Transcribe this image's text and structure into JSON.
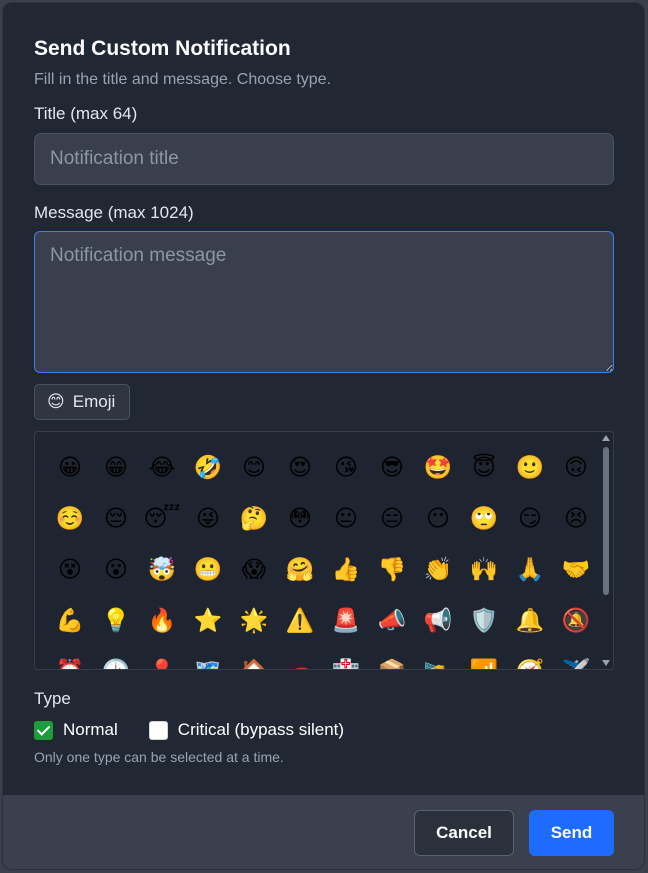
{
  "dialog": {
    "title": "Send Custom Notification",
    "subtitle": "Fill in the title and message. Choose type."
  },
  "form": {
    "title_label": "Title (max 64)",
    "title_placeholder": "Notification title",
    "message_label": "Message (max 1024)",
    "message_placeholder": "Notification message"
  },
  "emoji_button": {
    "icon": "😊",
    "label": "Emoji"
  },
  "emoji_grid": [
    "😀",
    "😁",
    "😂",
    "🤣",
    "😊",
    "😍",
    "😘",
    "😎",
    "🤩",
    "😇",
    "🙂",
    "🙃",
    "☺️",
    "😔",
    "😴",
    "😜",
    "🤔",
    "😳",
    "😐",
    "😑",
    "😶",
    "🙄",
    "😏",
    "😣",
    "😵",
    "😮",
    "🤯",
    "😬",
    "😱",
    "🤗",
    "👍",
    "👎",
    "👏",
    "🙌",
    "🙏",
    "🤝",
    "💪",
    "💡",
    "🔥",
    "⭐",
    "🌟",
    "⚠️",
    "🚨",
    "📣",
    "📢",
    "🛡️",
    "🔔",
    "🔕",
    "⏰",
    "🕑",
    "📍",
    "🗺️",
    "🏠",
    "🚗",
    "🏥",
    "📦",
    "🛰️",
    "📶",
    "🧭",
    "✈️"
  ],
  "type": {
    "label": "Type",
    "options": [
      {
        "label": "Normal",
        "checked": true
      },
      {
        "label": "Critical (bypass silent)",
        "checked": false
      }
    ],
    "hint": "Only one type can be selected at a time."
  },
  "footer": {
    "cancel_label": "Cancel",
    "send_label": "Send"
  },
  "colors": {
    "background": "#212733",
    "footer": "#3a404d",
    "accent": "#1e6bff",
    "focus_border": "#3d7ef0",
    "checkbox_on": "#1e9b3a"
  }
}
